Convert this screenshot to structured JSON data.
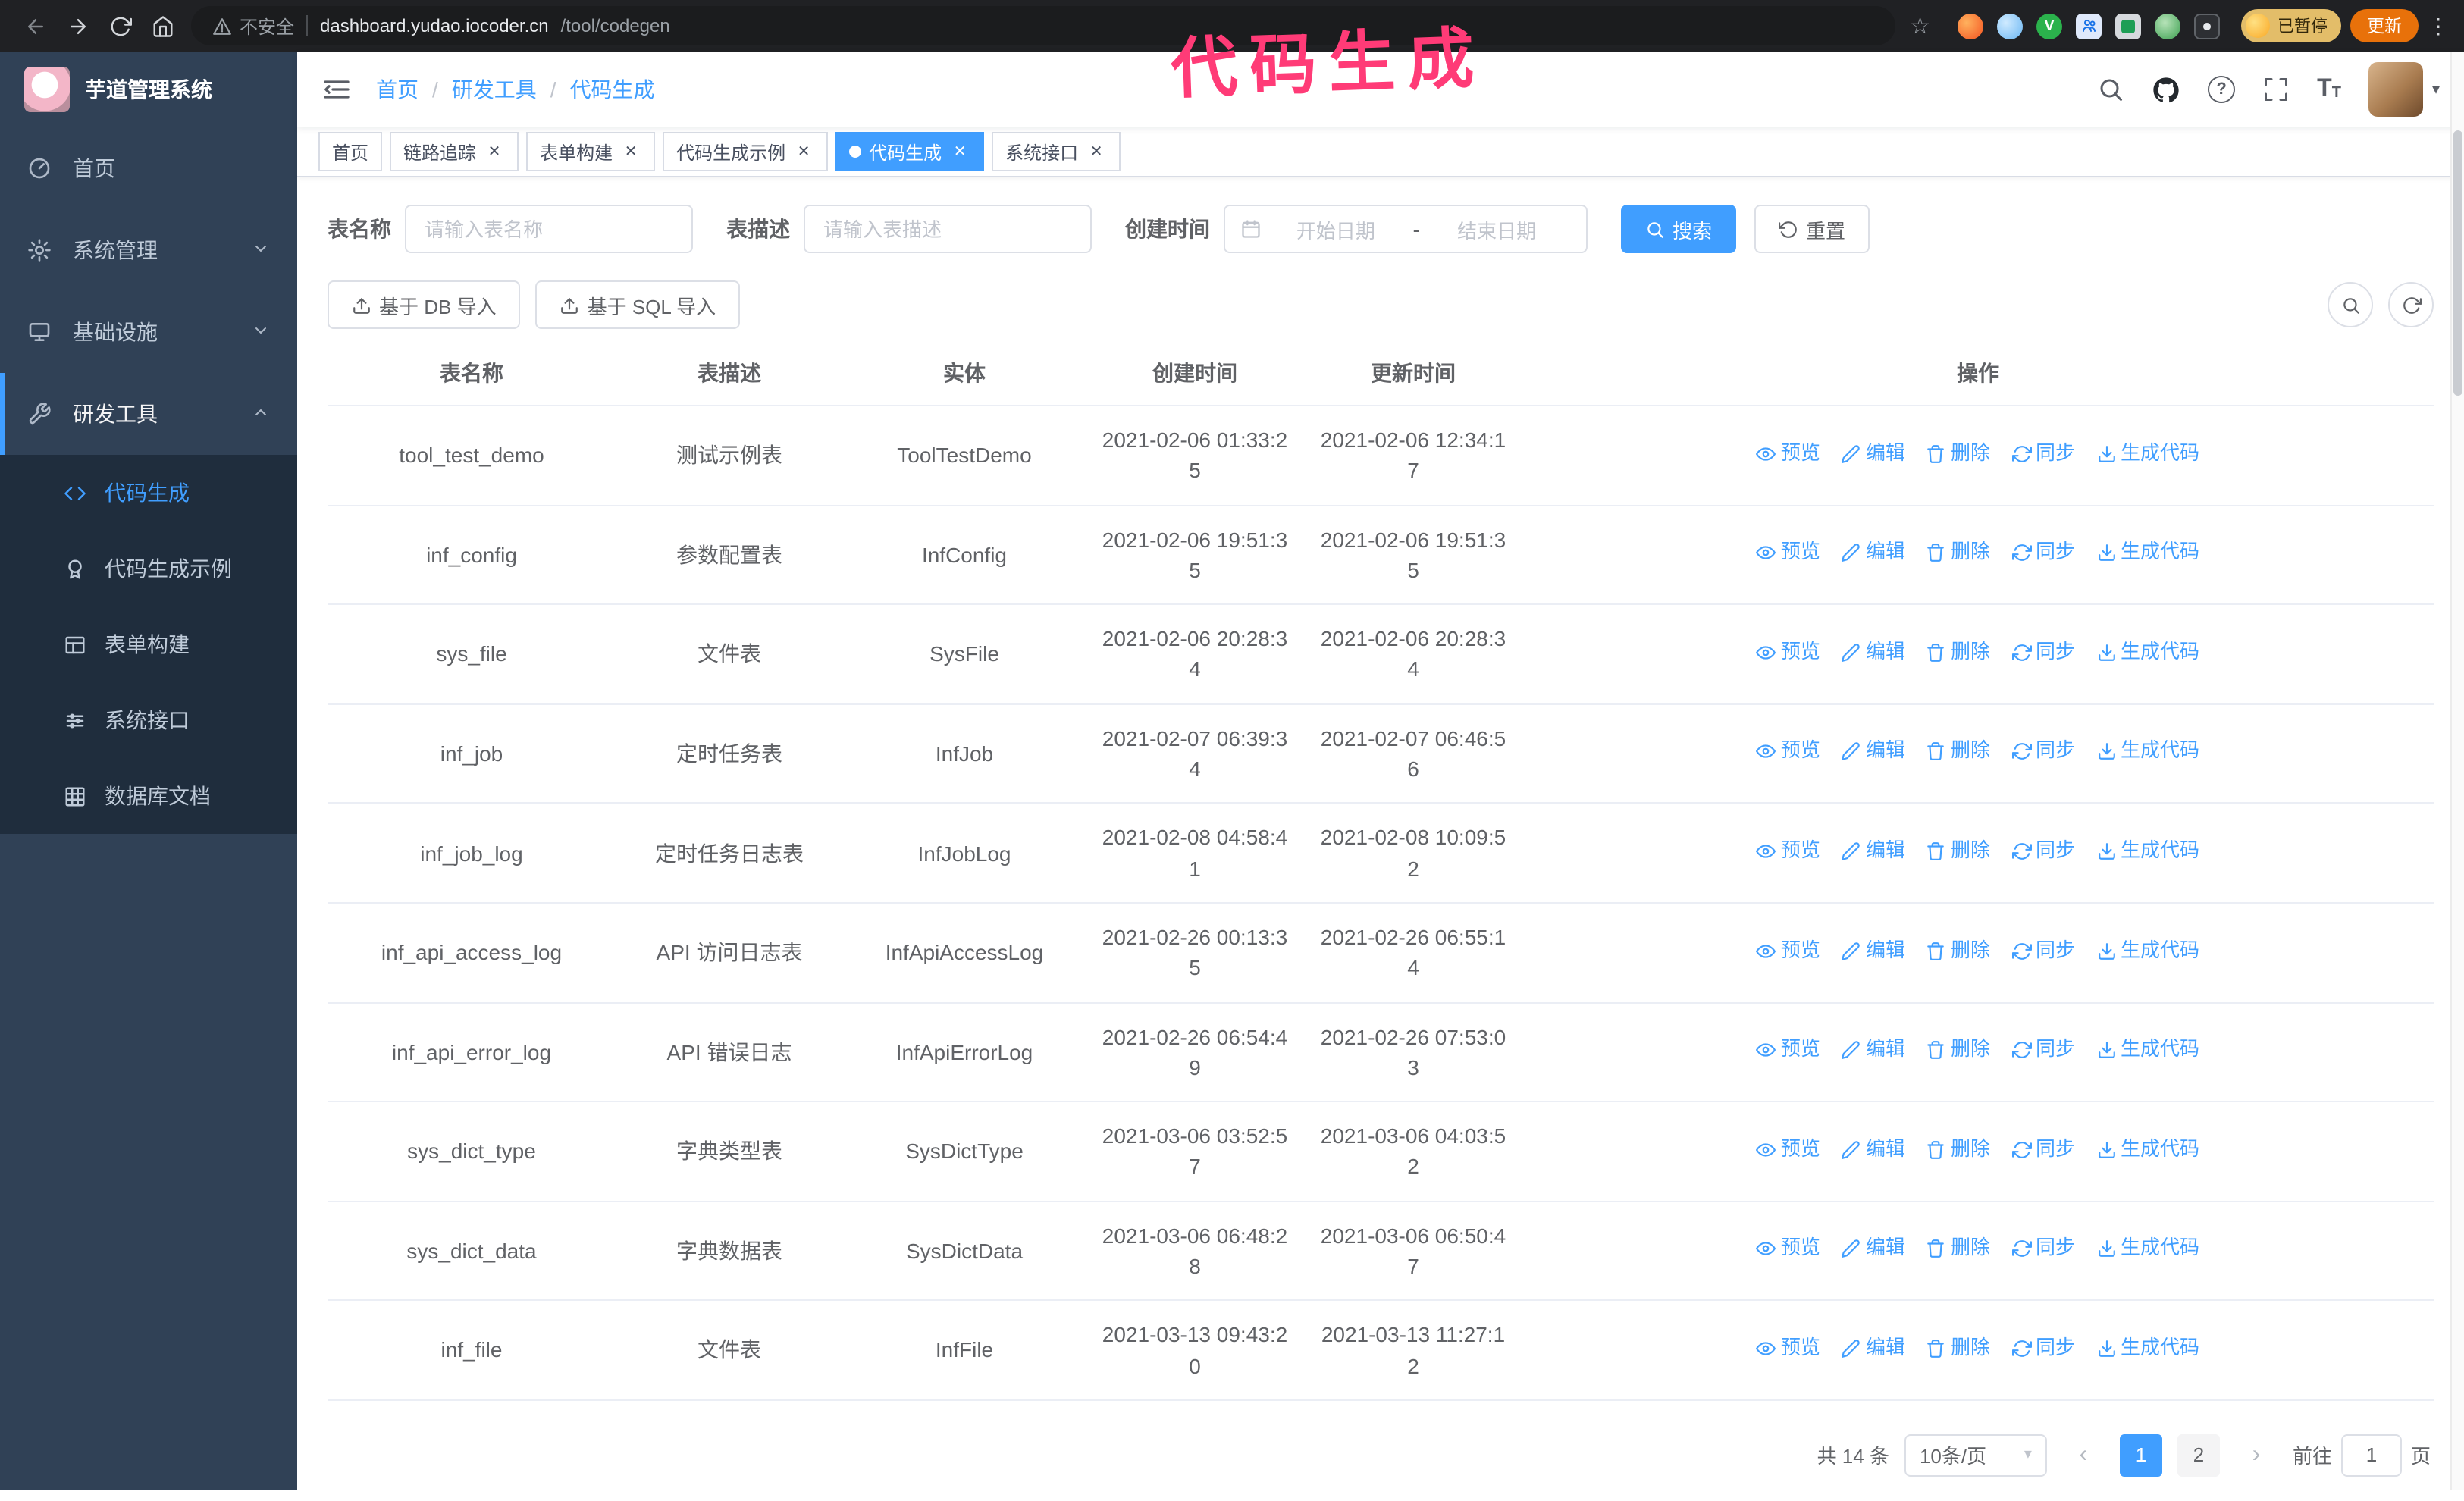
{
  "colors": {
    "accent": "#409EFF",
    "sidebar": "#304156",
    "submenu": "#1f2d3d",
    "annotation": "#ff3b77"
  },
  "annotation": {
    "text": "代码生成"
  },
  "browser": {
    "security_label": "不安全",
    "url_host": "dashboard.yudao.iocoder.cn",
    "url_path": "/tool/codegen",
    "paused_badge": "已暂停",
    "update_button": "更新"
  },
  "icons": {
    "close": "✕",
    "star": "☆",
    "kebab": "⋮",
    "help": "?",
    "font": "T",
    "caret": "▾",
    "prev": "‹",
    "next": "›"
  },
  "sidebar": {
    "logo_title": "芋道管理系统",
    "items": [
      {
        "label": "首页",
        "icon": "dashboard-icon"
      },
      {
        "label": "系统管理",
        "icon": "gear-icon"
      },
      {
        "label": "基础设施",
        "icon": "monitor-icon"
      },
      {
        "label": "研发工具",
        "icon": "wrench-icon"
      }
    ],
    "submenu": [
      {
        "label": "代码生成",
        "icon": "code-icon",
        "active": true
      },
      {
        "label": "代码生成示例",
        "icon": "badge-icon",
        "active": false
      },
      {
        "label": "表单构建",
        "icon": "form-icon",
        "active": false
      },
      {
        "label": "系统接口",
        "icon": "api-icon",
        "active": false
      },
      {
        "label": "数据库文档",
        "icon": "db-doc-icon",
        "active": false
      }
    ]
  },
  "header": {
    "breadcrumb": [
      "首页",
      "研发工具",
      "代码生成"
    ],
    "breadcrumb_sep": "/"
  },
  "tabs": [
    {
      "label": "首页",
      "closable": false,
      "active": false
    },
    {
      "label": "链路追踪",
      "closable": true,
      "active": false
    },
    {
      "label": "表单构建",
      "closable": true,
      "active": false
    },
    {
      "label": "代码生成示例",
      "closable": true,
      "active": false
    },
    {
      "label": "代码生成",
      "closable": true,
      "active": true
    },
    {
      "label": "系统接口",
      "closable": true,
      "active": false
    }
  ],
  "filter": {
    "name_label": "表名称",
    "name_placeholder": "请输入表名称",
    "desc_label": "表描述",
    "desc_placeholder": "请输入表描述",
    "time_label": "创建时间",
    "start_placeholder": "开始日期",
    "range_separator": "-",
    "end_placeholder": "结束日期",
    "search_button": "搜索",
    "reset_button": "重置"
  },
  "toolbar": {
    "import_db": "基于 DB 导入",
    "import_sql": "基于 SQL 导入"
  },
  "table": {
    "headers": [
      "表名称",
      "表描述",
      "实体",
      "创建时间",
      "更新时间",
      "操作"
    ],
    "actions": [
      {
        "key": "preview",
        "label": "预览",
        "icon": "eye-icon"
      },
      {
        "key": "edit",
        "label": "编辑",
        "icon": "edit-icon"
      },
      {
        "key": "delete",
        "label": "删除",
        "icon": "delete-icon"
      },
      {
        "key": "sync",
        "label": "同步",
        "icon": "sync-icon"
      },
      {
        "key": "generate",
        "label": "生成代码",
        "icon": "download-icon"
      }
    ],
    "rows": [
      {
        "name": "tool_test_demo",
        "desc": "测试示例表",
        "entity": "ToolTestDemo",
        "created": "2021-02-06 01:33:25",
        "updated": "2021-02-06 12:34:17"
      },
      {
        "name": "inf_config",
        "desc": "参数配置表",
        "entity": "InfConfig",
        "created": "2021-02-06 19:51:35",
        "updated": "2021-02-06 19:51:35"
      },
      {
        "name": "sys_file",
        "desc": "文件表",
        "entity": "SysFile",
        "created": "2021-02-06 20:28:34",
        "updated": "2021-02-06 20:28:34"
      },
      {
        "name": "inf_job",
        "desc": "定时任务表",
        "entity": "InfJob",
        "created": "2021-02-07 06:39:34",
        "updated": "2021-02-07 06:46:56"
      },
      {
        "name": "inf_job_log",
        "desc": "定时任务日志表",
        "entity": "InfJobLog",
        "created": "2021-02-08 04:58:41",
        "updated": "2021-02-08 10:09:52"
      },
      {
        "name": "inf_api_access_log",
        "desc": "API 访问日志表",
        "entity": "InfApiAccessLog",
        "created": "2021-02-26 00:13:35",
        "updated": "2021-02-26 06:55:14"
      },
      {
        "name": "inf_api_error_log",
        "desc": "API 错误日志",
        "entity": "InfApiErrorLog",
        "created": "2021-02-26 06:54:49",
        "updated": "2021-02-26 07:53:03"
      },
      {
        "name": "sys_dict_type",
        "desc": "字典类型表",
        "entity": "SysDictType",
        "created": "2021-03-06 03:52:57",
        "updated": "2021-03-06 04:03:52"
      },
      {
        "name": "sys_dict_data",
        "desc": "字典数据表",
        "entity": "SysDictData",
        "created": "2021-03-06 06:48:28",
        "updated": "2021-03-06 06:50:47"
      },
      {
        "name": "inf_file",
        "desc": "文件表",
        "entity": "InfFile",
        "created": "2021-03-13 09:43:20",
        "updated": "2021-03-13 11:27:12"
      }
    ]
  },
  "pagination": {
    "total": "共 14 条",
    "page_size": "10条/页",
    "pages": [
      "1",
      "2"
    ],
    "active_page": "1",
    "goto_label": "前往",
    "goto_value": "1",
    "goto_suffix": "页"
  }
}
